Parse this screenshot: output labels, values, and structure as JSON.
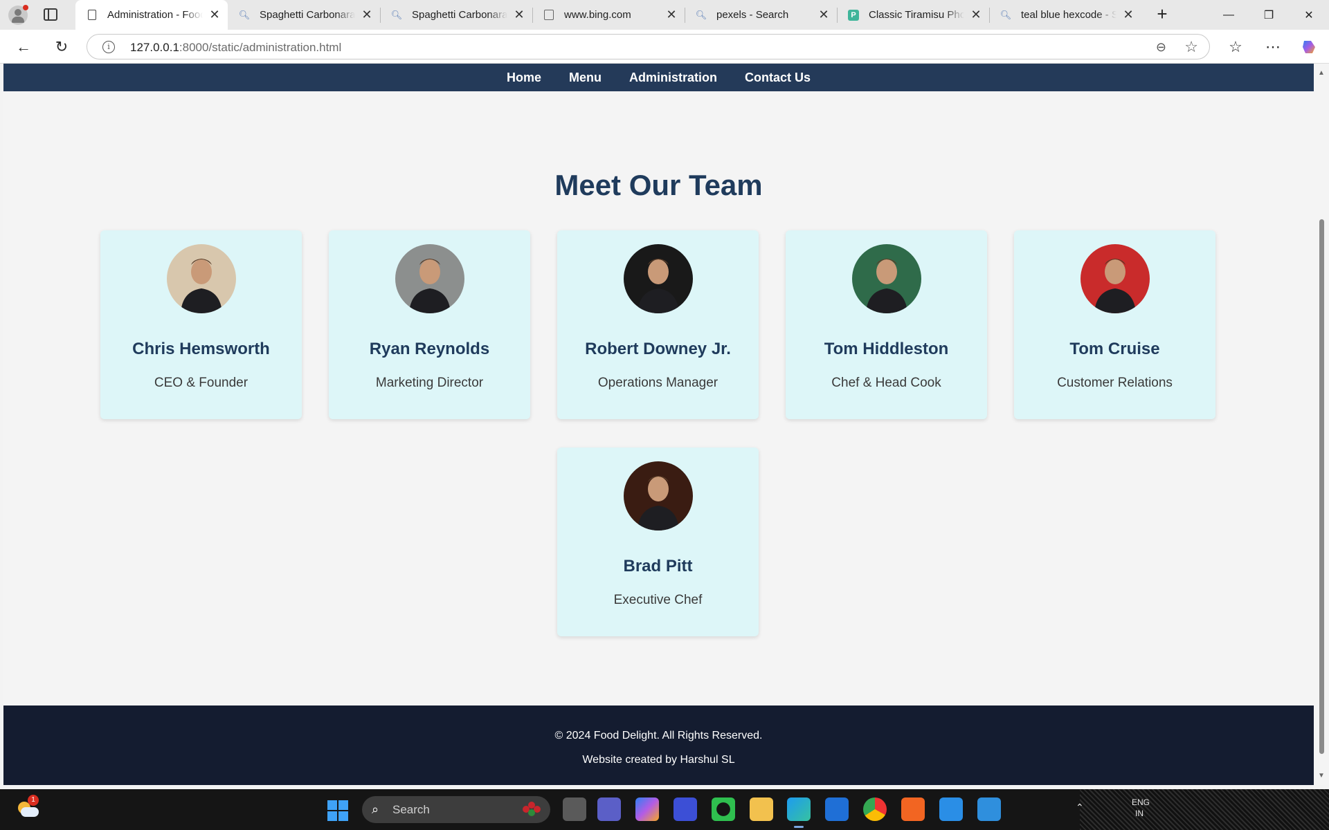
{
  "browser": {
    "tabs": [
      {
        "title": "Administration - Food Delight",
        "icon": "page-icon",
        "active": true
      },
      {
        "title": "Spaghetti Carbonara - Search",
        "icon": "search-icon",
        "active": false
      },
      {
        "title": "Spaghetti Carbonara - Search",
        "icon": "search-icon",
        "active": false
      },
      {
        "title": "www.bing.com",
        "icon": "page-error-icon",
        "active": false
      },
      {
        "title": "pexels - Search",
        "icon": "search-icon",
        "active": false
      },
      {
        "title": "Classic Tiramisu Photos",
        "icon": "pexels-icon",
        "active": false
      },
      {
        "title": "teal blue hexcode - Search",
        "icon": "search-icon",
        "active": false
      }
    ],
    "url_host": "127.0.0.1",
    "url_rest": ":8000/static/administration.html"
  },
  "site": {
    "nav": [
      "Home",
      "Menu",
      "Administration",
      "Contact Us"
    ],
    "heading": "Meet Our Team",
    "team": [
      {
        "name": "Chris Hemsworth",
        "role": "CEO & Founder",
        "avatar_bg": "#d8c7ad"
      },
      {
        "name": "Ryan Reynolds",
        "role": "Marketing Director",
        "avatar_bg": "#8c8f8e"
      },
      {
        "name": "Robert Downey Jr.",
        "role": "Operations Manager",
        "avatar_bg": "#191919"
      },
      {
        "name": "Tom Hiddleston",
        "role": "Chef & Head Cook",
        "avatar_bg": "#2f6b4a"
      },
      {
        "name": "Tom Cruise",
        "role": "Customer Relations",
        "avatar_bg": "#c92b2b"
      },
      {
        "name": "Brad Pitt",
        "role": "Executive Chef",
        "avatar_bg": "#3a1c12"
      }
    ],
    "footer_copyright": "© 2024 Food Delight. All Rights Reserved.",
    "footer_credit": "Website created by Harshul SL"
  },
  "taskbar": {
    "weather_badge": "1",
    "search_placeholder": "Search",
    "tray_lang": "ENG",
    "tray_region": "IN"
  },
  "colors": {
    "nav_bg": "#243a59",
    "card_bg": "#ddf6f8",
    "heading": "#1f3b5c",
    "footer_bg": "#141c30"
  }
}
